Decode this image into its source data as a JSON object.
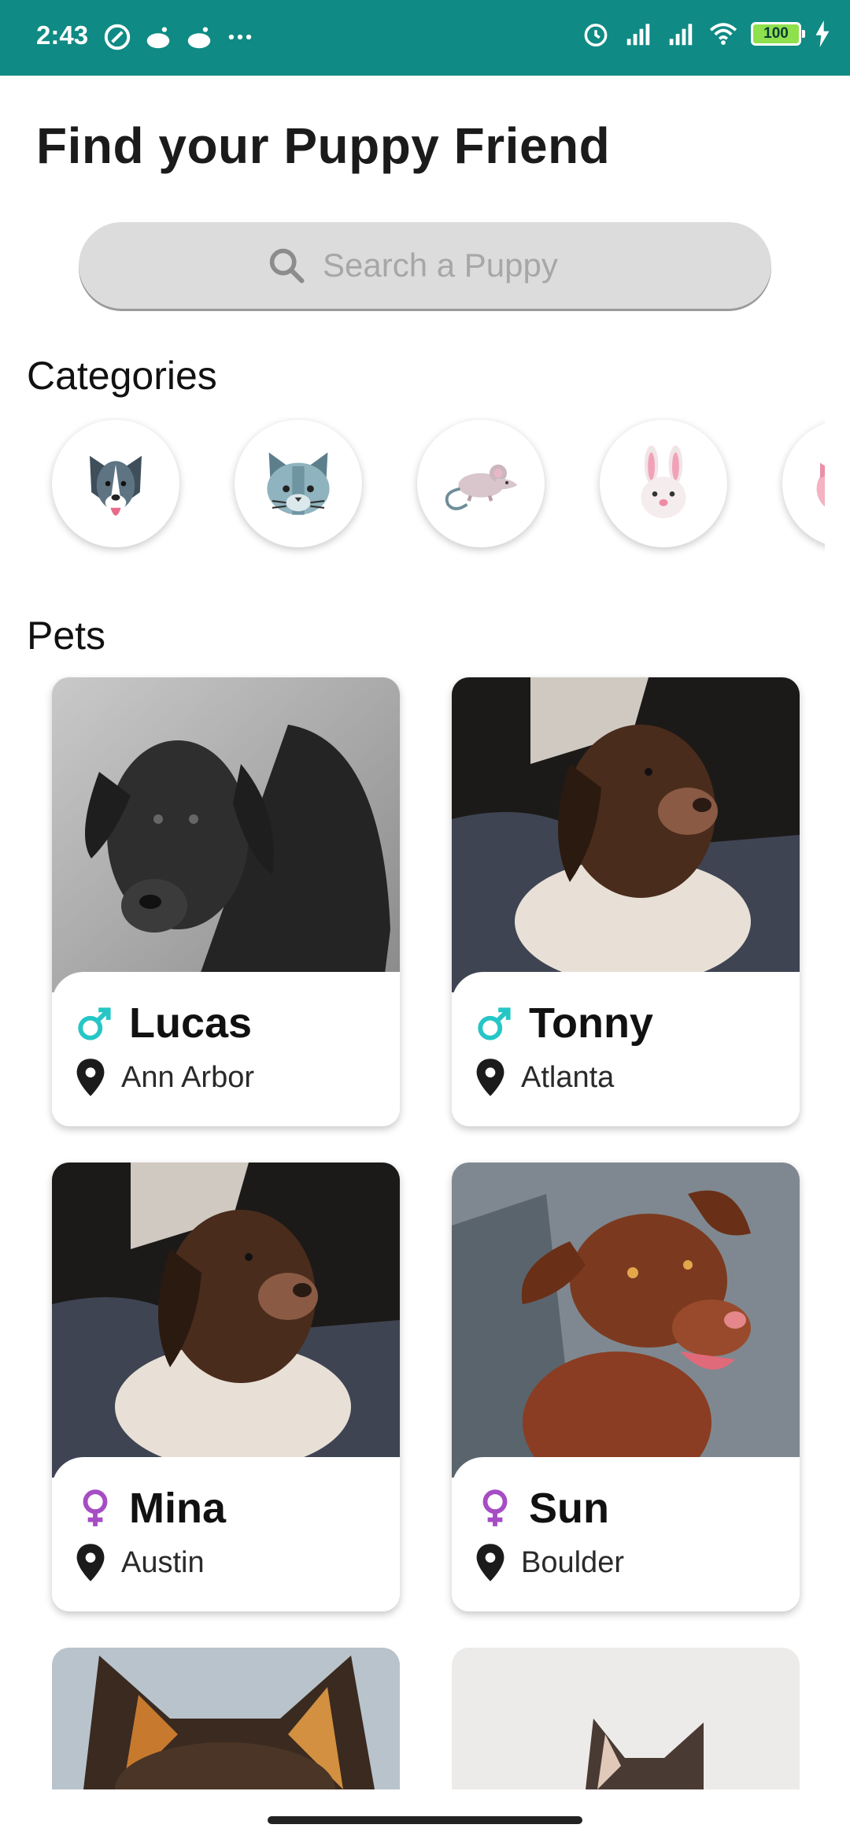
{
  "status_bar": {
    "time": "2:43",
    "battery": "100"
  },
  "header": {
    "title": "Find your Puppy Friend"
  },
  "search": {
    "placeholder": "Search a Puppy"
  },
  "categories": {
    "heading": "Categories",
    "items": [
      {
        "name": "dog",
        "icon": "dog-icon"
      },
      {
        "name": "cat",
        "icon": "cat-icon"
      },
      {
        "name": "mouse",
        "icon": "mouse-icon"
      },
      {
        "name": "rabbit",
        "icon": "rabbit-icon"
      },
      {
        "name": "pig",
        "icon": "pig-icon"
      }
    ]
  },
  "pets": {
    "heading": "Pets",
    "items": [
      {
        "name": "Lucas",
        "location": "Ann Arbor",
        "gender": "male",
        "icon": "male-icon"
      },
      {
        "name": "Tonny",
        "location": "Atlanta",
        "gender": "male",
        "icon": "male-icon"
      },
      {
        "name": "Mina",
        "location": "Austin",
        "gender": "female",
        "icon": "female-icon"
      },
      {
        "name": "Sun",
        "location": "Boulder",
        "gender": "female",
        "icon": "female-icon"
      }
    ]
  },
  "colors": {
    "status_bar": "#0f8a84",
    "male": "#26c6c6",
    "female": "#a64cc4"
  }
}
